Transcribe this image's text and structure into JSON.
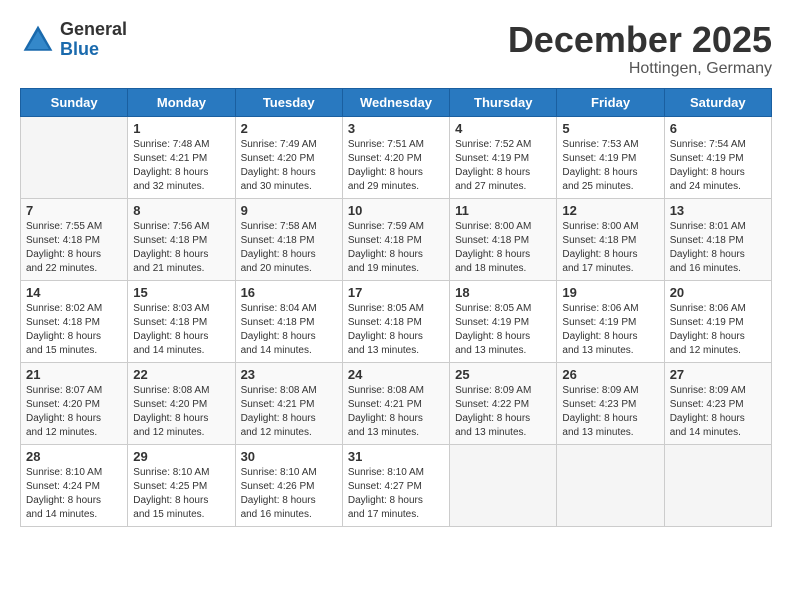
{
  "header": {
    "logo_general": "General",
    "logo_blue": "Blue",
    "month_title": "December 2025",
    "location": "Hottingen, Germany"
  },
  "days_of_week": [
    "Sunday",
    "Monday",
    "Tuesday",
    "Wednesday",
    "Thursday",
    "Friday",
    "Saturday"
  ],
  "weeks": [
    [
      {
        "day": "",
        "info": ""
      },
      {
        "day": "1",
        "info": "Sunrise: 7:48 AM\nSunset: 4:21 PM\nDaylight: 8 hours\nand 32 minutes."
      },
      {
        "day": "2",
        "info": "Sunrise: 7:49 AM\nSunset: 4:20 PM\nDaylight: 8 hours\nand 30 minutes."
      },
      {
        "day": "3",
        "info": "Sunrise: 7:51 AM\nSunset: 4:20 PM\nDaylight: 8 hours\nand 29 minutes."
      },
      {
        "day": "4",
        "info": "Sunrise: 7:52 AM\nSunset: 4:19 PM\nDaylight: 8 hours\nand 27 minutes."
      },
      {
        "day": "5",
        "info": "Sunrise: 7:53 AM\nSunset: 4:19 PM\nDaylight: 8 hours\nand 25 minutes."
      },
      {
        "day": "6",
        "info": "Sunrise: 7:54 AM\nSunset: 4:19 PM\nDaylight: 8 hours\nand 24 minutes."
      }
    ],
    [
      {
        "day": "7",
        "info": "Sunrise: 7:55 AM\nSunset: 4:18 PM\nDaylight: 8 hours\nand 22 minutes."
      },
      {
        "day": "8",
        "info": "Sunrise: 7:56 AM\nSunset: 4:18 PM\nDaylight: 8 hours\nand 21 minutes."
      },
      {
        "day": "9",
        "info": "Sunrise: 7:58 AM\nSunset: 4:18 PM\nDaylight: 8 hours\nand 20 minutes."
      },
      {
        "day": "10",
        "info": "Sunrise: 7:59 AM\nSunset: 4:18 PM\nDaylight: 8 hours\nand 19 minutes."
      },
      {
        "day": "11",
        "info": "Sunrise: 8:00 AM\nSunset: 4:18 PM\nDaylight: 8 hours\nand 18 minutes."
      },
      {
        "day": "12",
        "info": "Sunrise: 8:00 AM\nSunset: 4:18 PM\nDaylight: 8 hours\nand 17 minutes."
      },
      {
        "day": "13",
        "info": "Sunrise: 8:01 AM\nSunset: 4:18 PM\nDaylight: 8 hours\nand 16 minutes."
      }
    ],
    [
      {
        "day": "14",
        "info": "Sunrise: 8:02 AM\nSunset: 4:18 PM\nDaylight: 8 hours\nand 15 minutes."
      },
      {
        "day": "15",
        "info": "Sunrise: 8:03 AM\nSunset: 4:18 PM\nDaylight: 8 hours\nand 14 minutes."
      },
      {
        "day": "16",
        "info": "Sunrise: 8:04 AM\nSunset: 4:18 PM\nDaylight: 8 hours\nand 14 minutes."
      },
      {
        "day": "17",
        "info": "Sunrise: 8:05 AM\nSunset: 4:18 PM\nDaylight: 8 hours\nand 13 minutes."
      },
      {
        "day": "18",
        "info": "Sunrise: 8:05 AM\nSunset: 4:19 PM\nDaylight: 8 hours\nand 13 minutes."
      },
      {
        "day": "19",
        "info": "Sunrise: 8:06 AM\nSunset: 4:19 PM\nDaylight: 8 hours\nand 13 minutes."
      },
      {
        "day": "20",
        "info": "Sunrise: 8:06 AM\nSunset: 4:19 PM\nDaylight: 8 hours\nand 12 minutes."
      }
    ],
    [
      {
        "day": "21",
        "info": "Sunrise: 8:07 AM\nSunset: 4:20 PM\nDaylight: 8 hours\nand 12 minutes."
      },
      {
        "day": "22",
        "info": "Sunrise: 8:08 AM\nSunset: 4:20 PM\nDaylight: 8 hours\nand 12 minutes."
      },
      {
        "day": "23",
        "info": "Sunrise: 8:08 AM\nSunset: 4:21 PM\nDaylight: 8 hours\nand 12 minutes."
      },
      {
        "day": "24",
        "info": "Sunrise: 8:08 AM\nSunset: 4:21 PM\nDaylight: 8 hours\nand 13 minutes."
      },
      {
        "day": "25",
        "info": "Sunrise: 8:09 AM\nSunset: 4:22 PM\nDaylight: 8 hours\nand 13 minutes."
      },
      {
        "day": "26",
        "info": "Sunrise: 8:09 AM\nSunset: 4:23 PM\nDaylight: 8 hours\nand 13 minutes."
      },
      {
        "day": "27",
        "info": "Sunrise: 8:09 AM\nSunset: 4:23 PM\nDaylight: 8 hours\nand 14 minutes."
      }
    ],
    [
      {
        "day": "28",
        "info": "Sunrise: 8:10 AM\nSunset: 4:24 PM\nDaylight: 8 hours\nand 14 minutes."
      },
      {
        "day": "29",
        "info": "Sunrise: 8:10 AM\nSunset: 4:25 PM\nDaylight: 8 hours\nand 15 minutes."
      },
      {
        "day": "30",
        "info": "Sunrise: 8:10 AM\nSunset: 4:26 PM\nDaylight: 8 hours\nand 16 minutes."
      },
      {
        "day": "31",
        "info": "Sunrise: 8:10 AM\nSunset: 4:27 PM\nDaylight: 8 hours\nand 17 minutes."
      },
      {
        "day": "",
        "info": ""
      },
      {
        "day": "",
        "info": ""
      },
      {
        "day": "",
        "info": ""
      }
    ]
  ]
}
